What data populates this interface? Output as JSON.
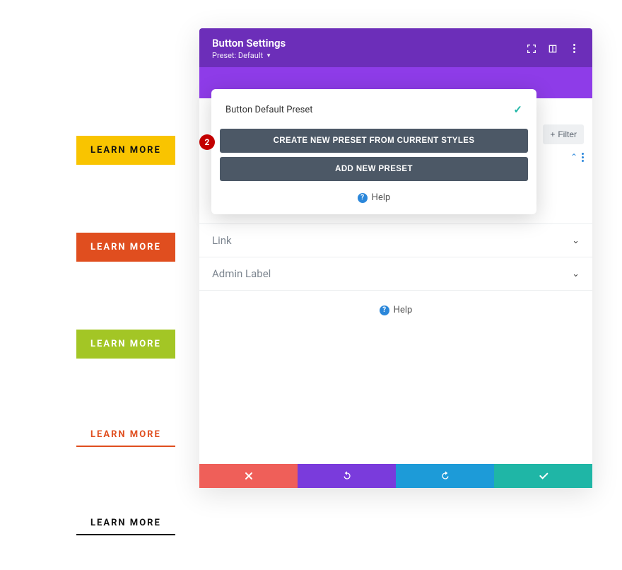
{
  "demo_buttons": {
    "yellow": "LEARN MORE",
    "orange": "LEARN MORE",
    "green": "LEARN MORE",
    "text_red": "LEARN MORE",
    "text_black": "LEARN MORE"
  },
  "panel": {
    "title": "Button Settings",
    "preset_label": "Preset: Default"
  },
  "preset_popover": {
    "selected": "Button Default Preset",
    "create_btn": "CREATE NEW PRESET FROM CURRENT STYLES",
    "add_btn": "ADD NEW PRESET",
    "help": "Help"
  },
  "filter_button": "Filter",
  "accordion": {
    "link": "Link",
    "admin_label": "Admin Label"
  },
  "body_help": "Help",
  "step_badge": "2",
  "colors": {
    "purple_header": "#6c2eb9",
    "purple_strip": "#8e3ce8",
    "teal": "#1fb6a6",
    "footer_red": "#ef5f59",
    "footer_purple": "#7a3bdc",
    "footer_blue": "#1d9bd8",
    "btn_yellow": "#f9c400",
    "btn_orange": "#e04e1f",
    "btn_green": "#a3c625",
    "badge_red": "#c30000"
  }
}
